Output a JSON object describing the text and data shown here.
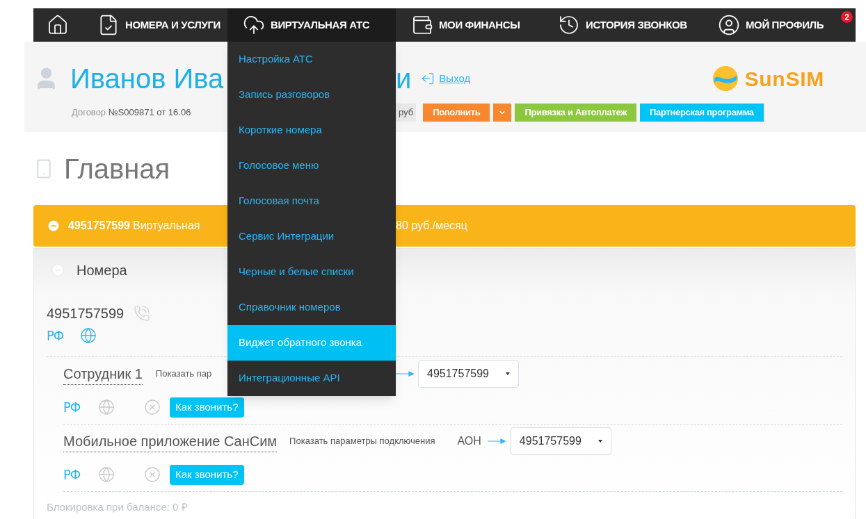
{
  "nav": {
    "items": [
      {
        "kind": "home",
        "selected": false
      },
      {
        "kind": "services",
        "label": "НОМЕРА И УСЛУГИ",
        "selected": false
      },
      {
        "kind": "pbx",
        "label": "ВИРТУАЛЬНАЯ АТС",
        "selected": true
      },
      {
        "kind": "finance",
        "label": "МОИ ФИНАНСЫ",
        "selected": false
      },
      {
        "kind": "history",
        "label": "ИСТОРИЯ ЗВОНКОВ",
        "selected": false
      },
      {
        "kind": "profile",
        "label": "МОЙ ПРОФИЛЬ",
        "selected": false,
        "badge": "2"
      }
    ]
  },
  "dropdown": {
    "items": [
      {
        "label": "Настройка АТС",
        "selected": false
      },
      {
        "label": "Запись разговоров",
        "selected": false
      },
      {
        "label": "Короткие номера",
        "selected": false
      },
      {
        "label": "Голосовое меню",
        "selected": false
      },
      {
        "label": "Голосовая почта",
        "selected": false
      },
      {
        "label": "Сервис Интеграции",
        "selected": false
      },
      {
        "label": "Черные и белые списки",
        "selected": false
      },
      {
        "label": "Справочник номеров",
        "selected": false
      },
      {
        "label": "Виджет обратного звонка",
        "selected": true
      },
      {
        "label": "Интеграционные API",
        "selected": false
      }
    ]
  },
  "header": {
    "name_left": "Иванов Ива",
    "name_right": "и",
    "logout": "Выход",
    "logo": "SunSIM",
    "contract_label": "Договор",
    "contract_value": "№S009871 от 16.06",
    "balance_fragment": "руб",
    "buttons": [
      {
        "kind": "text",
        "label": "Пополнить",
        "color": "#f7882f"
      },
      {
        "kind": "caret",
        "color": "#f7882f"
      },
      {
        "kind": "text",
        "label": "Привязка и Автоплатеж",
        "color": "#8dc63f"
      },
      {
        "kind": "text",
        "label": "Партнерская программа",
        "color": "#00c3f5"
      }
    ]
  },
  "page_title": "Главная",
  "banner": {
    "expanded": true,
    "number": "4951757599",
    "text_left": "Виртуальная",
    "text_right": "80 руб./месяц"
  },
  "panel": {
    "title": "Номера",
    "expanded": true,
    "number": "4951757599",
    "region": "РФ",
    "web_enabled": true,
    "employees": [
      {
        "name": "Сотрудник 1",
        "params_link": "Показать пар",
        "number": "4951757599",
        "region": "РФ",
        "web_enabled": false,
        "call_button": "Как звонить?"
      },
      {
        "name": "Мобильное приложение СанСим",
        "params_link": "Показать параметры подключения",
        "aon_label": "АОН",
        "number": "4951757599",
        "region": "РФ",
        "web_enabled": false,
        "call_button": "Как звонить?"
      }
    ],
    "footer": "Блокировка при балансе: 0 ₽"
  }
}
